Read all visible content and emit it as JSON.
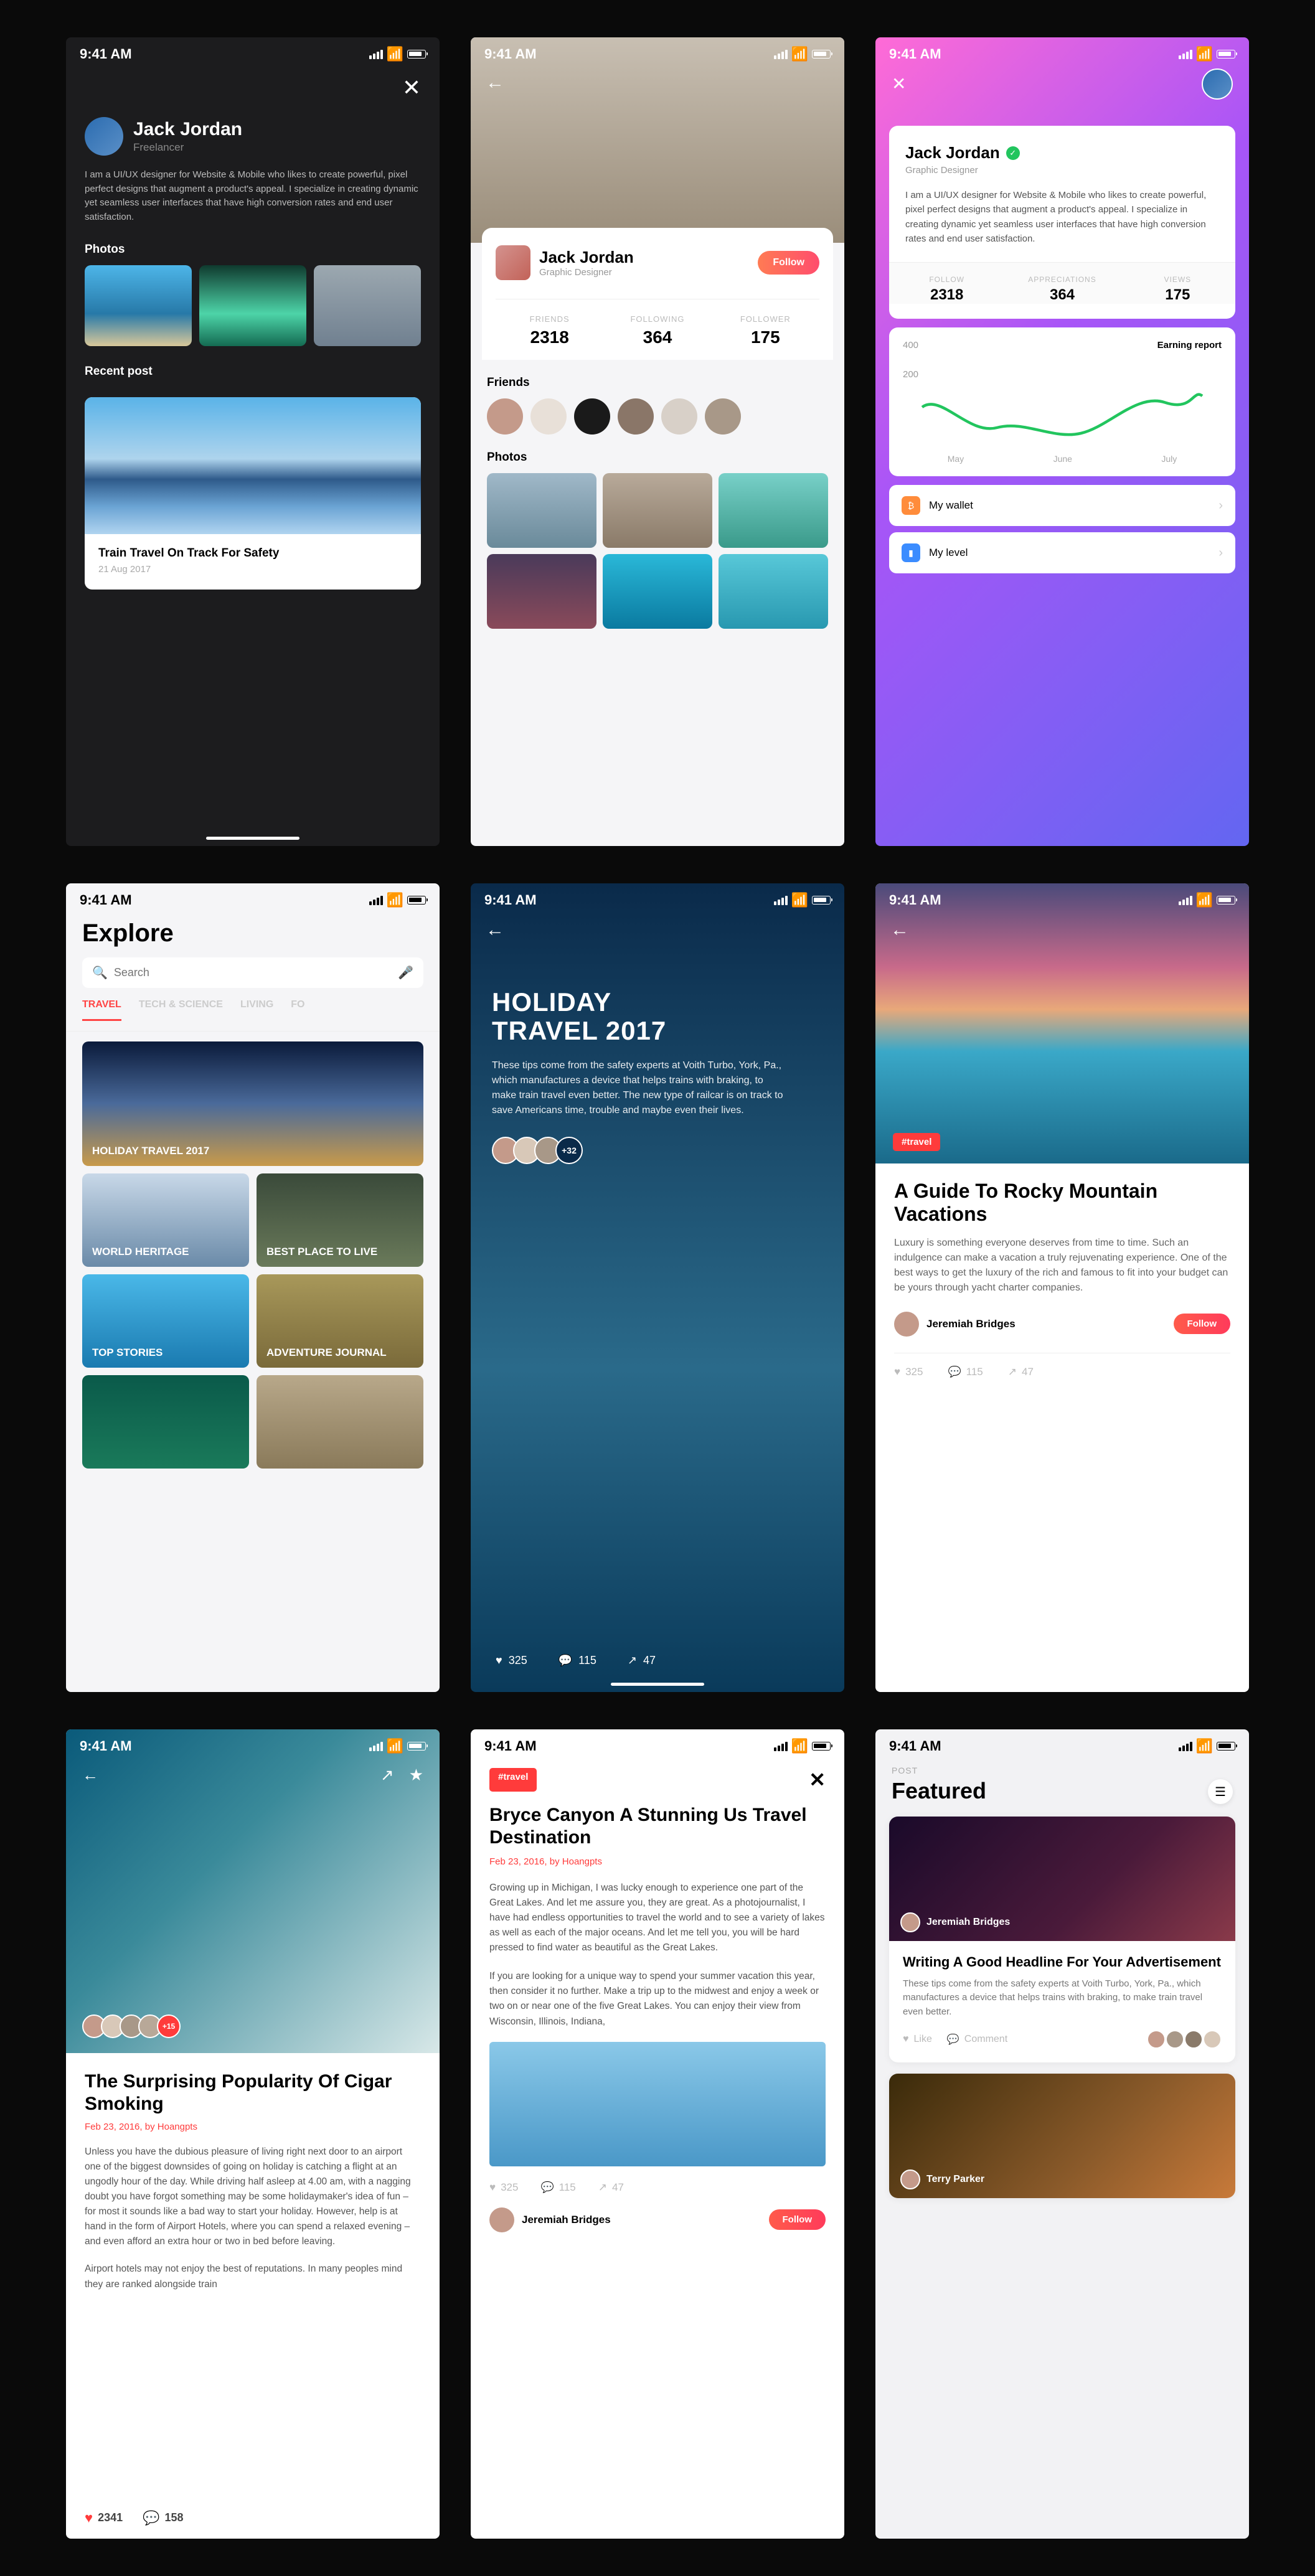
{
  "status_time": "9:41 AM",
  "s1": {
    "name": "Jack Jordan",
    "role": "Freelancer",
    "bio": "I am a UI/UX designer for Website & Mobile who likes to create powerful, pixel perfect designs that augment a product's appeal. I specialize in creating dynamic yet seamless user interfaces that have high conversion rates and end user satisfaction.",
    "photos_label": "Photos",
    "recent_label": "Recent post",
    "card_title": "Train Travel On Track For Safety",
    "card_date": "21 Aug 2017"
  },
  "s2": {
    "name": "Jack Jordan",
    "role": "Graphic Designer",
    "follow": "Follow",
    "stats": [
      {
        "label": "FRIENDS",
        "value": "2318"
      },
      {
        "label": "FOLLOWING",
        "value": "364"
      },
      {
        "label": "FOLLOWER",
        "value": "175"
      }
    ],
    "friends_label": "Friends",
    "photos_label": "Photos"
  },
  "s3": {
    "name": "Jack Jordan",
    "role": "Graphic Designer",
    "bio": "I am a UI/UX designer for Website & Mobile who likes to create powerful, pixel perfect designs that augment a product's appeal. I specialize in creating dynamic yet seamless user interfaces that have high conversion rates and end user satisfaction.",
    "stats": [
      {
        "label": "FOLLOW",
        "value": "2318"
      },
      {
        "label": "APPRECIATIONS",
        "value": "364"
      },
      {
        "label": "VIEWS",
        "value": "175"
      }
    ],
    "chart_max": "400",
    "chart_mid": "200",
    "chart_title": "Earning report",
    "months": [
      "May",
      "June",
      "July"
    ],
    "wallet": "My wallet",
    "level": "My level"
  },
  "s4": {
    "title": "Explore",
    "search": "Search",
    "tabs": [
      "TRAVEL",
      "TECH & SCIENCE",
      "LIVING",
      "FO"
    ],
    "tiles": [
      "HOLIDAY TRAVEL 2017",
      "WORLD HERITAGE",
      "BEST PLACE TO LIVE",
      "TOP STORIES",
      "ADVENTURE JOURNAL"
    ]
  },
  "s5": {
    "title_l1": "HOLIDAY",
    "title_l2": "TRAVEL 2017",
    "body": "These tips come from the safety experts at Voith Turbo, York, Pa., which manufactures a device that helps trains with braking, to make train travel even better. The new type of railcar is on track to save Americans time, trouble and maybe even their lives.",
    "more": "+32",
    "likes": "325",
    "comments": "115",
    "shares": "47"
  },
  "s6": {
    "tag": "#travel",
    "title": "A Guide To Rocky Mountain Vacations",
    "body": "Luxury is something everyone deserves from time to time. Such an indulgence can make a vacation a truly rejuvenating experience. One of the best ways to get the luxury of the rich and famous to fit into your budget can be yours through yacht charter companies.",
    "author": "Jeremiah Bridges",
    "follow": "Follow",
    "likes": "325",
    "comments": "115",
    "shares": "47"
  },
  "s7": {
    "title": "The Surprising Popularity Of Cigar Smoking",
    "date": "Feb 23, 2016, ",
    "by": "by ",
    "author": "Hoangpts",
    "more": "+15",
    "body1": "Unless you have the dubious pleasure of living right next door to an airport one of the biggest downsides of going on holiday is catching a flight at an ungodly hour of the day. While driving half asleep at 4.00 am, with a nagging doubt you have forgot something may be some holidaymaker's idea of fun – for most it sounds like a bad way to start your holiday. However, help is at hand in the form of Airport Hotels, where you can spend a relaxed evening – and even afford an extra hour or two in bed before leaving.",
    "body2": "Airport hotels may not enjoy the best of reputations. In many peoples mind they are ranked alongside train",
    "likes": "2341",
    "comments": "158"
  },
  "s8": {
    "tag": "#travel",
    "title": "Bryce Canyon A Stunning Us Travel Destination",
    "date": "Feb 23, 2016, ",
    "by": "by ",
    "author_meta": "Hoangpts",
    "body1": "Growing up in Michigan, I was lucky enough to experience one part of the Great Lakes. And let me assure you, they are great. As a photojournalist, I have had endless opportunities to travel the world and to see a variety of lakes as well as each of the major oceans. And let me tell you, you will be hard pressed to find water as beautiful as the Great Lakes.",
    "body2": "If you are looking for a unique way to spend your summer vacation this year, then consider it no further. Make a trip up to the midwest and enjoy a week or two on or near one of the five Great Lakes. You can enjoy their view from Wisconsin, Illinois, Indiana,",
    "likes": "325",
    "comments": "115",
    "shares": "47",
    "author": "Jeremiah Bridges",
    "follow": "Follow"
  },
  "s9": {
    "label": "POST",
    "title": "Featured",
    "card1_author": "Jeremiah Bridges",
    "card1_title": "Writing A Good Headline For Your Advertisement",
    "card1_body": "These tips come from the safety experts at Voith Turbo, York, Pa., which manufactures a device that helps trains with braking, to make train travel even better.",
    "like": "Like",
    "comment": "Comment",
    "card2_author": "Terry Parker"
  },
  "chart_data": {
    "type": "line",
    "title": "Earning report",
    "ylim": [
      0,
      400
    ],
    "categories": [
      "May",
      "June",
      "July"
    ],
    "values": [
      220,
      120,
      160,
      90,
      260,
      320
    ]
  }
}
